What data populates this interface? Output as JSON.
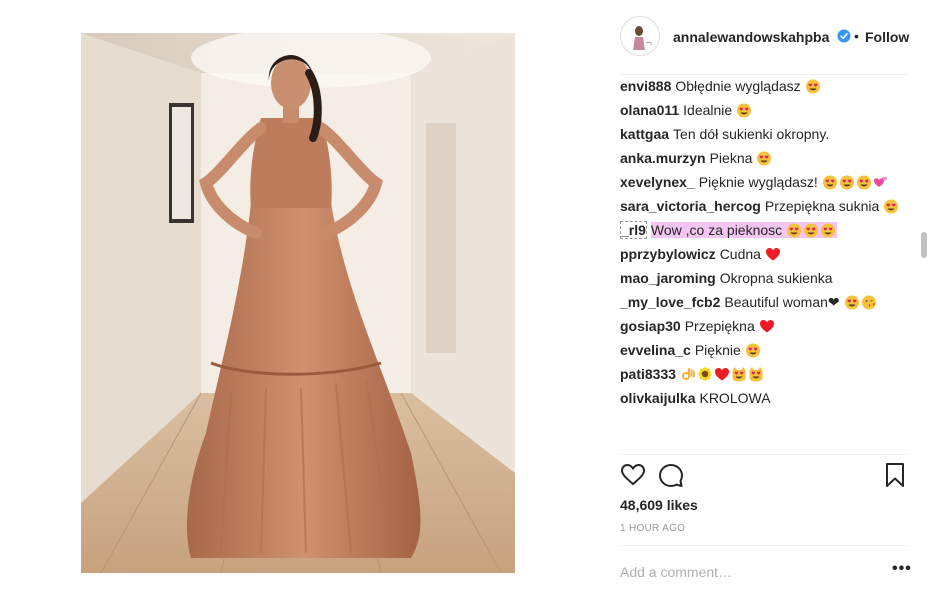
{
  "post": {
    "username": "annalewandowskahpba",
    "verified": true,
    "follow_label": "Follow",
    "separator": "•",
    "avatar_icon": "avatar-icon",
    "likes": "48,609 likes",
    "time": "1 HOUR AGO",
    "comment_placeholder": "Add a comment…",
    "more_label": "•••"
  },
  "comments": [
    {
      "user": "envi888",
      "text": "Obłędnie wyglądasz",
      "emojis": [
        "heart-eyes"
      ]
    },
    {
      "user": "olana011",
      "text": "Idealnie",
      "emojis": [
        "heart-eyes"
      ]
    },
    {
      "user": "kattgaa",
      "text": "Ten dół sukienki okropny.",
      "emojis": []
    },
    {
      "user": "anka.murzyn",
      "text": "Piekna",
      "emojis": [
        "heart-eyes"
      ]
    },
    {
      "user": "xevelynex_",
      "text": "Pięknie wyglądasz!",
      "emojis": [
        "heart-eyes",
        "heart-eyes",
        "heart-eyes",
        "pink-hearts"
      ]
    },
    {
      "user": "sara_victoria_hercog",
      "text": "Przepiękna suknia",
      "emojis": [
        "heart-eyes"
      ]
    },
    {
      "user": "_rl9",
      "text": "Wow ,co za pieknosc",
      "emojis": [
        "heart-eyes",
        "heart-eyes",
        "heart-eyes"
      ],
      "highlight": true
    },
    {
      "user": "pprzybylowicz",
      "text": "Cudna",
      "emojis": [
        "red-heart"
      ]
    },
    {
      "user": "mao_jaroming",
      "text": "Okropna sukienka",
      "emojis": []
    },
    {
      "user": "_my_love_fcb2",
      "text": "Beautiful woman❤",
      "emojis": [
        "heart-eyes",
        "kiss-face"
      ]
    },
    {
      "user": "gosiap30",
      "text": "Przepiękna",
      "emojis": [
        "red-heart"
      ]
    },
    {
      "user": "evvelina_c",
      "text": "Pięknie",
      "emojis": [
        "heart-eyes"
      ]
    },
    {
      "user": "pati8333",
      "text": "",
      "emojis": [
        "ok-hand",
        "sunflower",
        "red-heart",
        "heart-eyes-cat",
        "heart-eyes-cat"
      ]
    },
    {
      "user": "olivkaijulka",
      "text": "KROLOWA",
      "emojis": []
    }
  ],
  "colors": {
    "highlight": "#f2c5f3",
    "verified": "#3897f0",
    "heart": "#ed1c24",
    "dress": "#c98b6a"
  },
  "icons": {
    "like": "heart-outline-icon",
    "comment": "speech-bubble-icon",
    "save": "bookmark-icon",
    "verified": "verified-badge-icon"
  }
}
